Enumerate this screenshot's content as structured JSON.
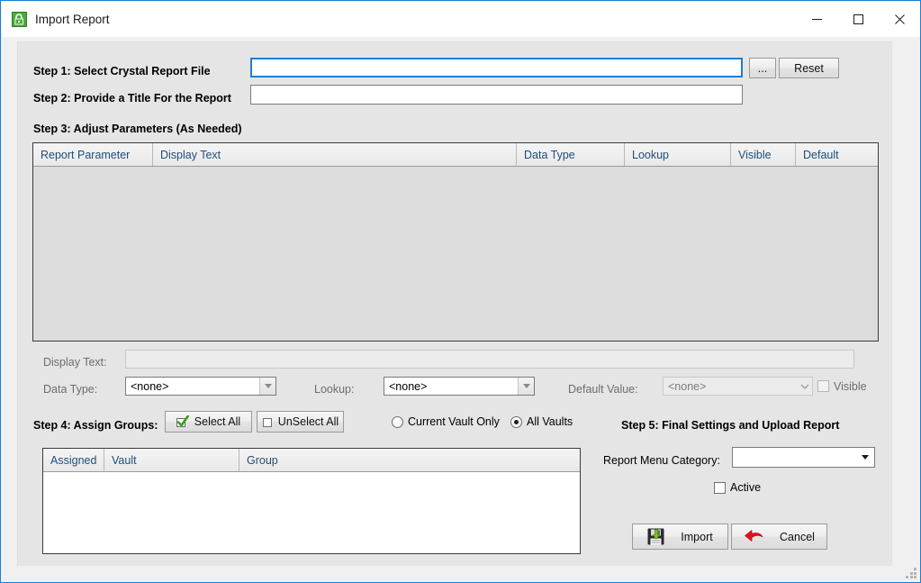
{
  "window": {
    "title": "Import Report",
    "app_icon": "lock-report-icon",
    "controls": {
      "minimize": "minimize-icon",
      "maximize": "maximize-icon",
      "close": "close-icon"
    }
  },
  "step1": {
    "label": "Step 1:  Select Crystal Report File",
    "file_value": "",
    "file_placeholder": "",
    "browse_label": "...",
    "reset_label": "Reset"
  },
  "step2": {
    "label": "Step 2:  Provide a Title For the Report",
    "title_value": "",
    "title_placeholder": ""
  },
  "step3": {
    "label": "Step 3:  Adjust Parameters (As Needed)",
    "columns": [
      "Report Parameter",
      "Display Text",
      "Data Type",
      "Lookup",
      "Visible",
      "Default"
    ],
    "rows": [],
    "detail": {
      "display_text_label": "Display Text:",
      "display_text_value": "",
      "data_type_label": "Data Type:",
      "data_type_value": "<none>",
      "lookup_label": "Lookup:",
      "lookup_value": "<none>",
      "default_value_label": "Default Value:",
      "default_value_value": "<none>",
      "visible_label": "Visible",
      "visible_checked": false
    }
  },
  "step4": {
    "label": "Step 4:  Assign Groups:",
    "select_all_label": "Select All",
    "unselect_all_label": "UnSelect All",
    "select_all_icon": "green-check-icon",
    "unselect_all_icon": "empty-box-icon",
    "scope": {
      "current_vault_label": "Current Vault Only",
      "all_vaults_label": "All Vaults",
      "selected": "All Vaults"
    },
    "columns": [
      "Assigned",
      "Vault",
      "Group"
    ],
    "rows": []
  },
  "step5": {
    "label": "Step 5:  Final Settings and Upload Report",
    "menu_category_label": "Report Menu Category:",
    "menu_category_value": "",
    "active_label": "Active",
    "active_checked": false,
    "import_label": "Import",
    "import_icon": "save-floppy-green-arrow-icon",
    "cancel_label": "Cancel",
    "cancel_icon": "red-arrow-icon"
  },
  "colors": {
    "window_border": "#1c7fd6",
    "panel_bg": "#e5e5e5",
    "dialog_bg": "#f0f0f0",
    "header_text": "#1f4e79",
    "focus_border": "#1c7fd6",
    "disabled_text": "#6d6d6d",
    "accent_green": "#4caf1e",
    "accent_red": "#e0161b"
  }
}
